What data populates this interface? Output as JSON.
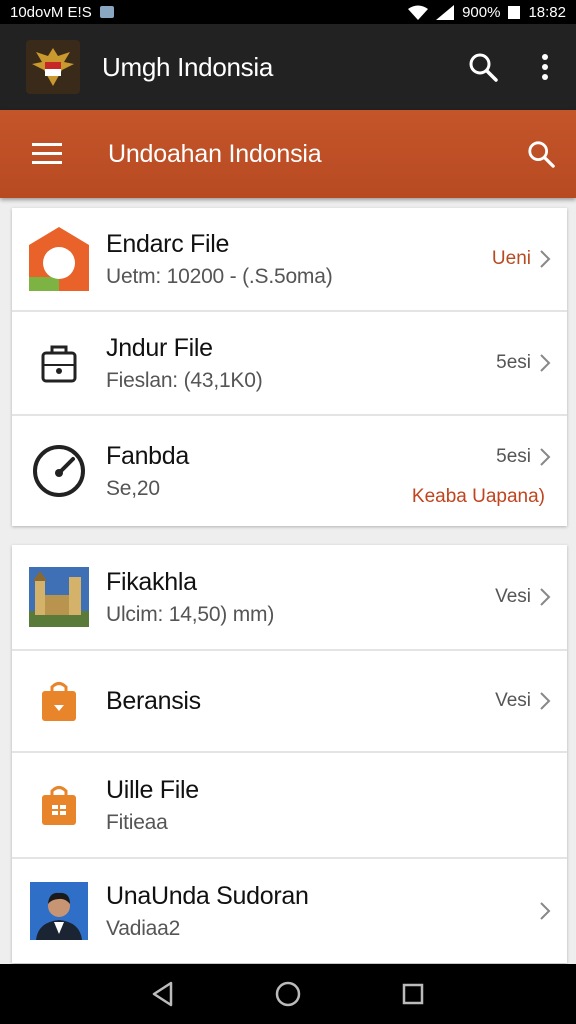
{
  "status": {
    "left_text": "10dovM E!S",
    "battery": "900%",
    "time": "18:82"
  },
  "appbar": {
    "title": "Umgh Indonsia"
  },
  "toolbar": {
    "title": "Undoahan Indonsia"
  },
  "list_a": [
    {
      "title": "Endarc File",
      "subtitle": "Uetm: 10200 - (.S.5oma)",
      "right": "Ueni",
      "icon": "orange-box-icon"
    },
    {
      "title": "Jndur File",
      "subtitle": "Fieslan: (43,1K0)",
      "right": "5esi",
      "icon": "lock-bag-icon"
    },
    {
      "title": "Fanbda",
      "subtitle": "Se,20",
      "right": "5esi",
      "note": "Keaba Uapana)",
      "icon": "gauge-icon"
    }
  ],
  "list_b": [
    {
      "title": "Fikakhla",
      "subtitle": "Ulcim: 14,50) mm)",
      "right": "Vesi",
      "icon": "monument-image-icon"
    },
    {
      "title": "Beransis",
      "subtitle": "",
      "right": "Vesi",
      "icon": "shopping-bag-icon"
    },
    {
      "title": "Uille File",
      "subtitle": "Fitieaa",
      "right": "",
      "icon": "briefcase-icon"
    },
    {
      "title": "UnaUnda Sudoran",
      "subtitle": "Vadiaa2",
      "right": "",
      "icon": "person-photo-icon"
    }
  ],
  "colors": {
    "accent": "#b84a22",
    "appbar": "#222222",
    "background": "#eeeeee"
  }
}
